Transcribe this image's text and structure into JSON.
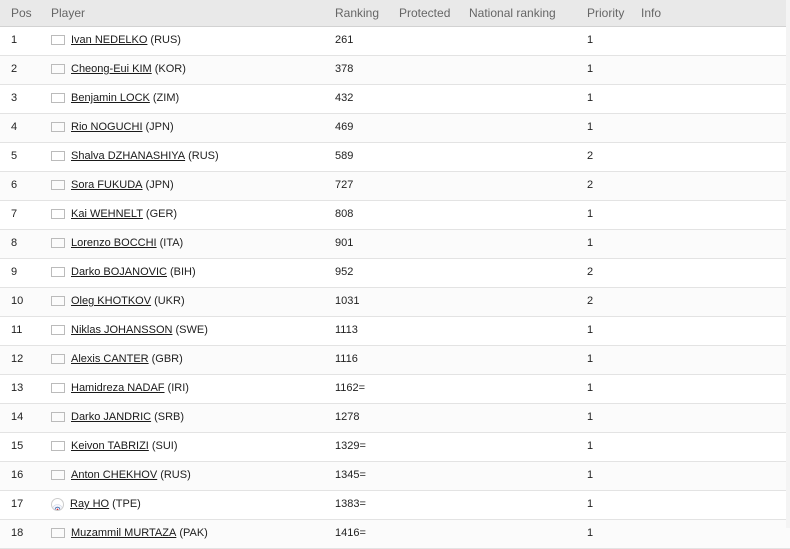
{
  "headers": {
    "pos": "Pos",
    "player": "Player",
    "ranking": "Ranking",
    "protected": "Protected",
    "national": "National ranking",
    "priority": "Priority",
    "info": "Info"
  },
  "rows": [
    {
      "pos": "1",
      "name": "Ivan NEDELKO",
      "country": "(RUS)",
      "flag": "rus-flag-icon",
      "ranking": "261",
      "priority": "1"
    },
    {
      "pos": "2",
      "name": "Cheong-Eui KIM",
      "country": "(KOR)",
      "flag": "kor-flag-icon",
      "ranking": "378",
      "priority": "1"
    },
    {
      "pos": "3",
      "name": "Benjamin LOCK",
      "country": "(ZIM)",
      "flag": "zim-flag-icon",
      "ranking": "432",
      "priority": "1"
    },
    {
      "pos": "4",
      "name": "Rio NOGUCHI",
      "country": "(JPN)",
      "flag": "jpn-flag-icon",
      "ranking": "469",
      "priority": "1"
    },
    {
      "pos": "5",
      "name": "Shalva DZHANASHIYA",
      "country": "(RUS)",
      "flag": "rus-flag-icon",
      "ranking": "589",
      "priority": "2"
    },
    {
      "pos": "6",
      "name": "Sora FUKUDA",
      "country": "(JPN)",
      "flag": "jpn-flag-icon",
      "ranking": "727",
      "priority": "2"
    },
    {
      "pos": "7",
      "name": "Kai WEHNELT",
      "country": "(GER)",
      "flag": "ger-flag-icon",
      "ranking": "808",
      "priority": "1"
    },
    {
      "pos": "8",
      "name": "Lorenzo BOCCHI",
      "country": "(ITA)",
      "flag": "ita-flag-icon",
      "ranking": "901",
      "priority": "1"
    },
    {
      "pos": "9",
      "name": "Darko BOJANOVIC",
      "country": "(BIH)",
      "flag": "bih-flag-icon",
      "ranking": "952",
      "priority": "2"
    },
    {
      "pos": "10",
      "name": "Oleg KHOTKOV",
      "country": "(UKR)",
      "flag": "ukr-flag-icon",
      "ranking": "1031",
      "priority": "2"
    },
    {
      "pos": "11",
      "name": "Niklas JOHANSSON",
      "country": "(SWE)",
      "flag": "swe-flag-icon",
      "ranking": "1113",
      "priority": "1"
    },
    {
      "pos": "12",
      "name": "Alexis CANTER",
      "country": "(GBR)",
      "flag": "gbr-flag-icon",
      "ranking": "1116",
      "priority": "1"
    },
    {
      "pos": "13",
      "name": "Hamidreza NADAF",
      "country": "(IRI)",
      "flag": "iri-flag-icon",
      "ranking": "1162=",
      "priority": "1"
    },
    {
      "pos": "14",
      "name": "Darko JANDRIC",
      "country": "(SRB)",
      "flag": "srb-flag-icon",
      "ranking": "1278",
      "priority": "1"
    },
    {
      "pos": "15",
      "name": "Keivon TABRIZI",
      "country": "(SUI)",
      "flag": "sui-flag-icon",
      "ranking": "1329=",
      "priority": "1"
    },
    {
      "pos": "16",
      "name": "Anton CHEKHOV",
      "country": "(RUS)",
      "flag": "rus-flag-icon",
      "ranking": "1345=",
      "priority": "1"
    },
    {
      "pos": "17",
      "name": "Ray HO",
      "country": "(TPE)",
      "flag": "tpe-flag-icon",
      "ranking": "1383=",
      "priority": "1"
    },
    {
      "pos": "18",
      "name": "Muzammil MURTAZA",
      "country": "(PAK)",
      "flag": "pak-flag-icon",
      "ranking": "1416=",
      "priority": "1"
    }
  ]
}
